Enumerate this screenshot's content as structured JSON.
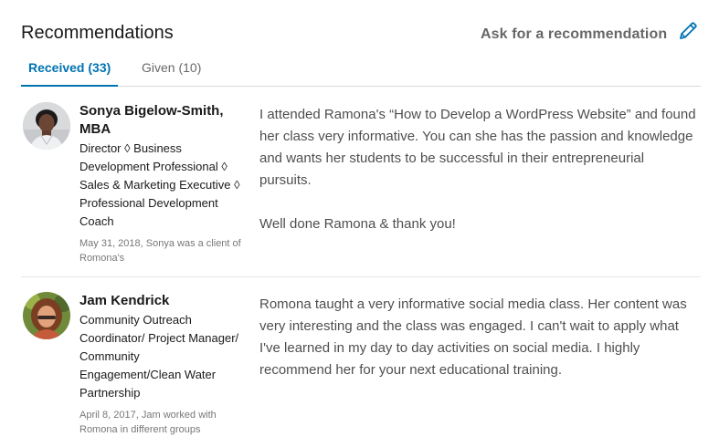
{
  "header": {
    "title": "Recommendations",
    "ask_label": "Ask for a recommendation",
    "edit_icon": "pencil-icon"
  },
  "tabs": [
    {
      "label": "Received (33)",
      "active": true
    },
    {
      "label": "Given (10)",
      "active": false
    }
  ],
  "recommendations": [
    {
      "name": "Sonya Bigelow-Smith, MBA",
      "headline": "Director ◊ Business Development Professional ◊ Sales & Marketing Executive ◊ Professional Development Coach",
      "meta": "May 31, 2018, Sonya was a client of Romona's",
      "paragraphs": [
        "I attended Ramona's “How to Develop a WordPress Website” and found her class very informative. You can she has the passion and knowledge and wants her students to be successful in their entrepreneurial pursuits.",
        "Well done Ramona & thank you!"
      ]
    },
    {
      "name": "Jam Kendrick",
      "headline": "Community Outreach Coordinator/ Project Manager/ Community Engagement/Clean Water Partnership",
      "meta": "April 8, 2017, Jam worked with Romona in different groups",
      "paragraphs": [
        "Romona taught a very informative social media class. Her content was very interesting and the class was engaged. I can't wait to apply what I've learned in my day to day activities on social media. I highly recommend her for your next educational training."
      ]
    }
  ],
  "colors": {
    "accent": "#0073b1",
    "divider": "#d9d9d9"
  }
}
